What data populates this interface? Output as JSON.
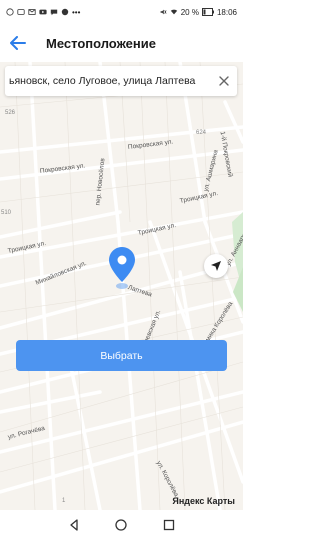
{
  "status_bar": {
    "battery": "20 %",
    "time": "18:06"
  },
  "header": {
    "title": "Местоположение"
  },
  "search": {
    "value": "ьяновск, село Луговое, улица Лаптева"
  },
  "map": {
    "streets": [
      "Покровская ул.",
      "Покровская ул.",
      "пер. Новосёлов",
      "1-й Покровский",
      "ул. Ашмарина",
      "Троицкая ул.",
      "Троицкая ул.",
      "Троицкая ул.",
      "Михайловская ул.",
      "Лаптева",
      "ул. Аннаарина",
      "Георгиевская ул.",
      "ул. Академика Королёва",
      "ул. Рогачёва",
      "ул. Королёва"
    ],
    "houses": [
      "526",
      "624",
      "510",
      "1"
    ]
  },
  "actions": {
    "choose_label": "Выбрать"
  },
  "attribution": "Яндекс Карты",
  "colors": {
    "accent": "#4d94f0",
    "map_bg": "#f6f3ee"
  }
}
